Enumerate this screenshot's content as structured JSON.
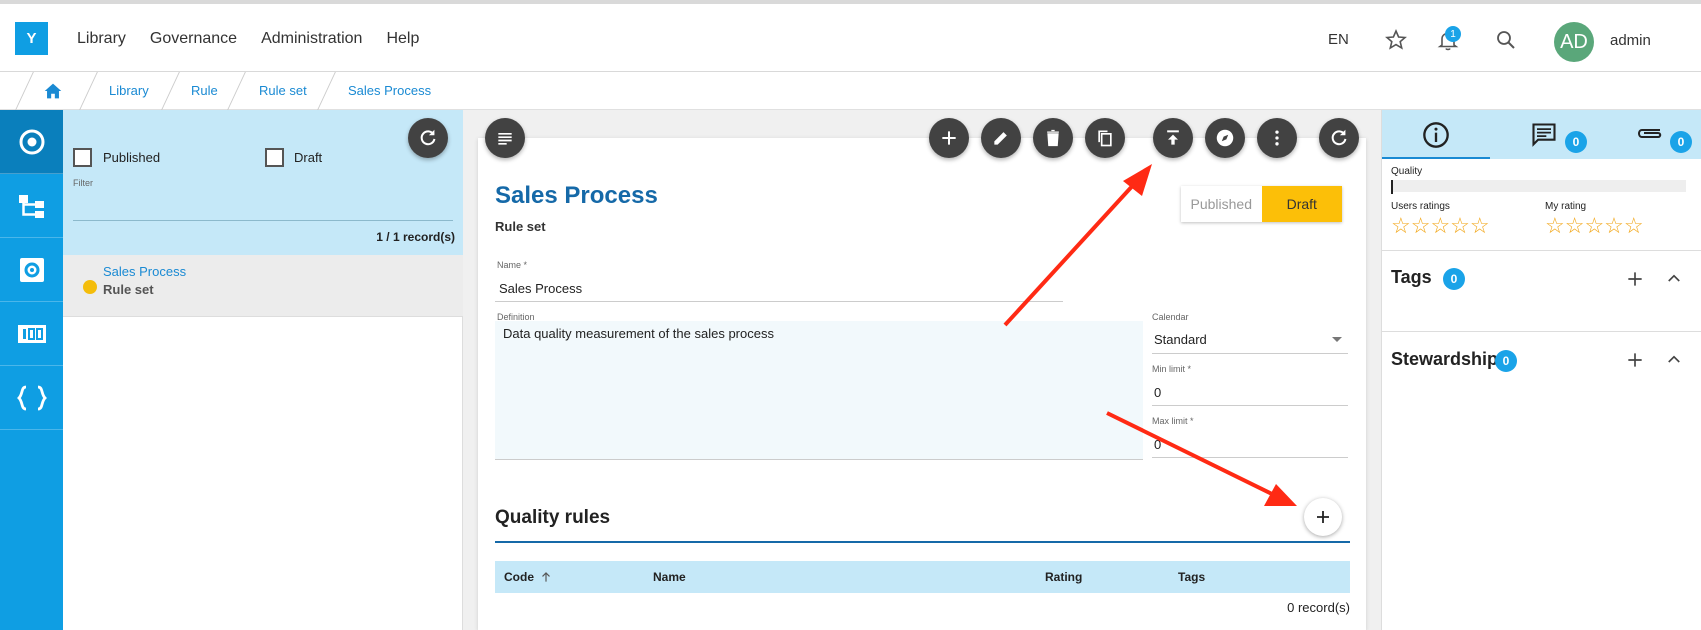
{
  "app": {
    "logo": "Y"
  },
  "nav": [
    "Library",
    "Governance",
    "Administration",
    "Help"
  ],
  "header": {
    "language": "EN",
    "notification_count": "1",
    "avatar_initials": "AD",
    "username": "admin"
  },
  "breadcrumb": [
    "Library",
    "Rule",
    "Rule set",
    "Sales Process"
  ],
  "rail": {
    "icons": [
      "target-icon",
      "hierarchy-icon",
      "settings-box-icon",
      "counter-icon",
      "braces-icon"
    ]
  },
  "filters": {
    "published_label": "Published",
    "draft_label": "Draft",
    "filter_label": "Filter",
    "records": "1 / 1 record(s)"
  },
  "list": {
    "items": [
      {
        "name": "Sales Process",
        "type": "Rule set",
        "status_color": "#f4bd0b"
      }
    ]
  },
  "detail": {
    "title": "Sales Process",
    "subtitle": "Rule set",
    "toggle": {
      "published": "Published",
      "draft": "Draft",
      "selected": "Draft"
    },
    "name_label": "Name *",
    "name_value": "Sales Process",
    "definition_label": "Definition",
    "definition_value": "Data quality measurement of the sales process",
    "calendar_label": "Calendar",
    "calendar_value": "Standard",
    "min_label": "Min limit *",
    "min_value": "0",
    "max_label": "Max limit *",
    "max_value": "0"
  },
  "quality_rules": {
    "title": "Quality rules",
    "columns": [
      "Code",
      "Name",
      "Rating",
      "Tags"
    ],
    "records": "0 record(s)"
  },
  "right_panel": {
    "comments_count": "0",
    "attachments_count": "0",
    "quality_label": "Quality",
    "users_ratings_label": "Users ratings",
    "my_rating_label": "My rating",
    "users_rating_stars": 0,
    "my_rating_stars": 0,
    "tags_label": "Tags",
    "tags_count": "0",
    "stewardship_label": "Stewardship",
    "stewardship_count": "0"
  },
  "colors": {
    "brand": "#0f9ee3",
    "draft": "#fcbf08",
    "title": "#1569a8",
    "annotation_arrow": "#ff2a14"
  }
}
